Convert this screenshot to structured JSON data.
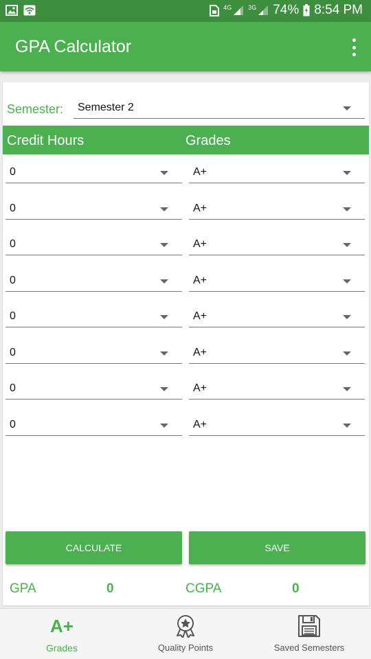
{
  "status_bar": {
    "network_1": "4G",
    "network_2": "3G",
    "battery": "74%",
    "time": "8:54 PM"
  },
  "app_bar": {
    "title": "GPA Calculator"
  },
  "semester": {
    "label": "Semester:",
    "selected": "Semester 2"
  },
  "table_header": {
    "credit_hours": "Credit Hours",
    "grades": "Grades"
  },
  "rows": [
    {
      "credit": "0",
      "grade": "A+"
    },
    {
      "credit": "0",
      "grade": "A+"
    },
    {
      "credit": "0",
      "grade": "A+"
    },
    {
      "credit": "0",
      "grade": "A+"
    },
    {
      "credit": "0",
      "grade": "A+"
    },
    {
      "credit": "0",
      "grade": "A+"
    },
    {
      "credit": "0",
      "grade": "A+"
    },
    {
      "credit": "0",
      "grade": "A+"
    }
  ],
  "actions": {
    "calculate": "CALCULATE",
    "save": "SAVE"
  },
  "results": {
    "gpa_label": "GPA",
    "gpa_value": "0",
    "cgpa_label": "CGPA",
    "cgpa_value": "0"
  },
  "bottom_nav": [
    {
      "label": "Grades",
      "icon": "aplus-icon",
      "icon_text": "A+",
      "active": true
    },
    {
      "label": "Quality Points",
      "icon": "award-ribbon-icon",
      "active": false
    },
    {
      "label": "Saved Semesters",
      "icon": "floppy-disk-icon",
      "active": false
    }
  ],
  "colors": {
    "primary": "#4caf50",
    "status_bar": "#3d8f3f"
  }
}
